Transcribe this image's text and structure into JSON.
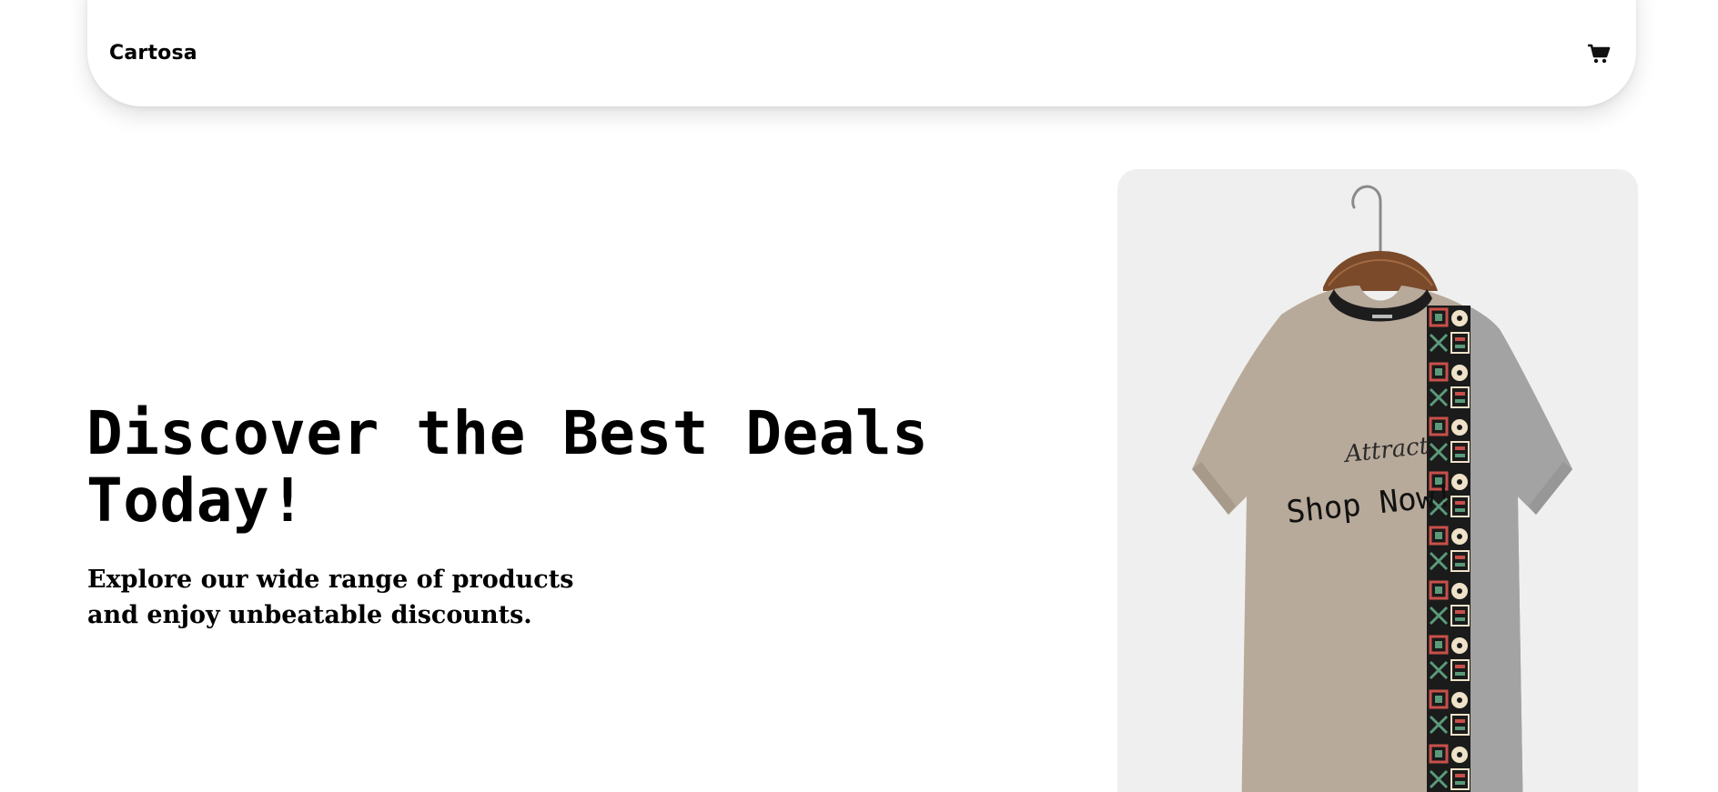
{
  "header": {
    "brand": "Cartosa",
    "cart_icon": "shopping-cart-icon"
  },
  "hero": {
    "title": "Discover the Best Deals Today!",
    "subtitle_line1": "Explore our wide range of products",
    "subtitle_line2": "and enjoy unbeatable discounts.",
    "cta_label": "Shop Now!"
  },
  "product_image": {
    "icon": "t-shirt-on-hanger",
    "shirt_logo_text": "Attract",
    "colors": {
      "card_bg": "#efefef",
      "shirt_main": "#b8aa9a",
      "shirt_right": "#a3a3a3",
      "hanger": "#7a4a2a",
      "pattern_dark": "#1b1b1b",
      "pattern_red": "#c8504a",
      "pattern_green": "#5a9a7a",
      "pattern_cream": "#efe2c8"
    }
  }
}
